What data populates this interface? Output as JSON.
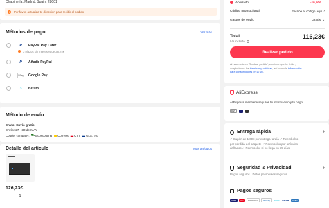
{
  "address": {
    "line": "Chapinería, Madrid, Spain, 28001",
    "warning": "Por favor, actualiza tu dirección para recibir el pedido"
  },
  "payment": {
    "title": "Métodos de pago",
    "more": "Ver más",
    "methods": [
      {
        "label": "PayPal Pay Later",
        "note": "3 plazos sin intereses de 38,74€",
        "icon": "paypal-icon"
      },
      {
        "label": "Añadir PayPal",
        "icon": "paypal-icon"
      },
      {
        "label": "Google Pay",
        "badge": "GPay",
        "icon": "google-pay-icon"
      },
      {
        "label": "Bizum",
        "icon": "bizum-icon"
      }
    ]
  },
  "shipping": {
    "title": "Método de envío",
    "free": "Envío: Envío gratis",
    "dates": "Envío: 27 - 30 de MAY",
    "carriers_label": "Courier company:",
    "carriers": [
      "Ecoscooting",
      "Correos",
      "CTT",
      "GLS",
      ", etc."
    ]
  },
  "items": {
    "title": "Detalle del artículo",
    "more": "Más artículos",
    "product": {
      "price": "126,23€",
      "qty": "1",
      "minus": "−",
      "plus": "+"
    }
  },
  "summary": {
    "saved_label": "Ahorrado",
    "saved_value": "-10,00€",
    "promo_label": "Código promocional",
    "promo_value": "Escribe el código aquí",
    "shipping_label": "Gastos de envío",
    "shipping_value": "Gratis",
    "total_label": "Total",
    "total_value": "116,23€",
    "vat_note": "IVA incluido",
    "cta": "Realizar pedido",
    "legal_1": "Al hacer clic en 'Realizar pedido', confirmo que he leído y",
    "legal_2a": "acepto todos los ",
    "legal_terms": "términos y políticas",
    "legal_2b": ", así como la ",
    "legal_info": "información",
    "legal_3": "para consumidores en la UE."
  },
  "trust": {
    "brand": "AliExpress",
    "text": "AliExpress mantiene seguros tu información y tu pago",
    "badges": [
      "DSS",
      "visa-icon",
      "lock-icon"
    ]
  },
  "benefits": {
    "fast": {
      "title": "Entrega rápida",
      "lines": [
        "✓ Cupón de 1,00€ por entrega tardía  ✓ Reembolso",
        "por pérdida del paquete  ✓ Reembolso por artículos",
        "dañados  ✓ Reembolso si no llega en 35 días"
      ]
    },
    "privacy": {
      "title": "Seguridad & Privacidad",
      "line": "Pagos seguros · Datos personales seguros"
    },
    "payments": {
      "title": "Pagos seguros",
      "logos": [
        "VISA",
        "MC",
        "Mastercard",
        "SafeKey",
        "Bizum",
        "PayPal",
        "AMEX"
      ]
    }
  },
  "colors": {
    "accent": "#fd384f",
    "link": "#1a5ae8",
    "warning_bg": "#fff2e8"
  }
}
